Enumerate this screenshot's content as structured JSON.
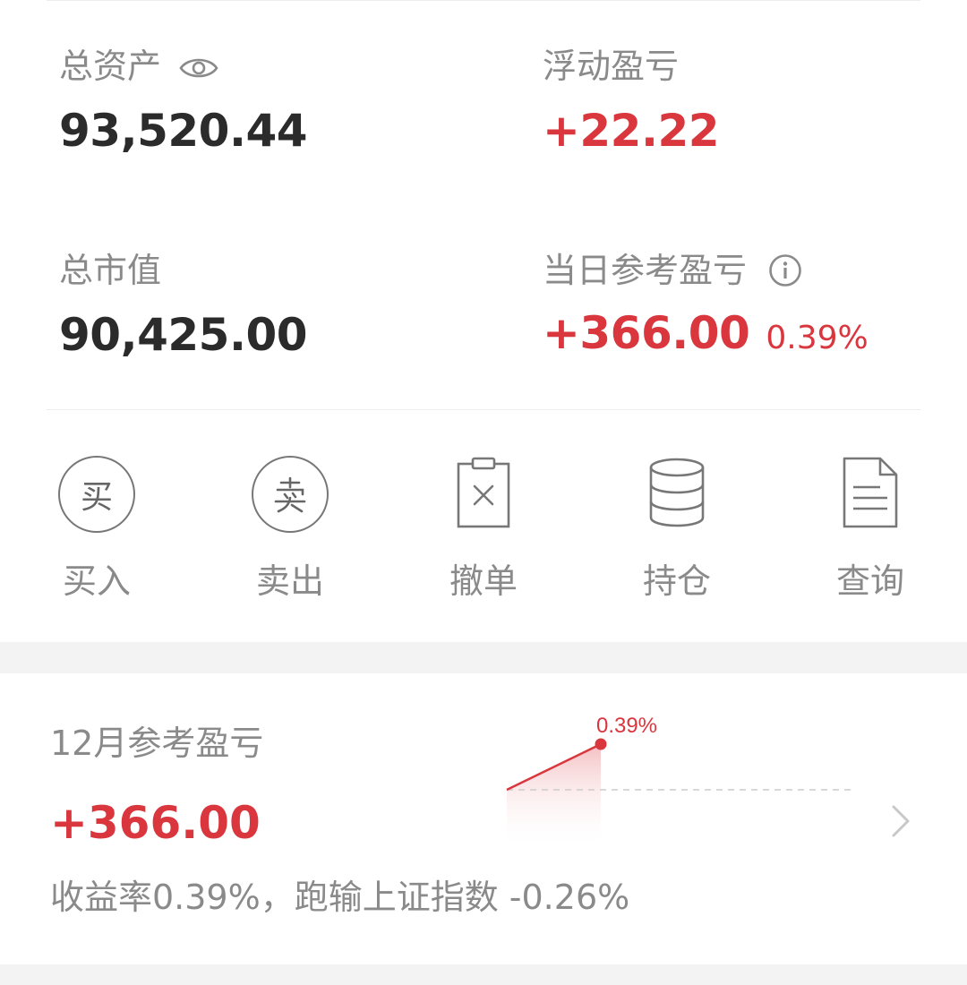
{
  "summary": {
    "total_assets": {
      "label": "总资产",
      "value": "93,520.44"
    },
    "floating_pnl": {
      "label": "浮动盈亏",
      "value": "+22.22"
    },
    "market_value": {
      "label": "总市值",
      "value": "90,425.00"
    },
    "daily_pnl": {
      "label": "当日参考盈亏",
      "value": "+366.00",
      "percent": "0.39%"
    }
  },
  "actions": [
    {
      "label": "买入",
      "icon": "buy-icon",
      "glyph": "买"
    },
    {
      "label": "卖出",
      "icon": "sell-icon",
      "glyph": "卖"
    },
    {
      "label": "撤单",
      "icon": "cancel-order-icon"
    },
    {
      "label": "持仓",
      "icon": "positions-icon"
    },
    {
      "label": "查询",
      "icon": "query-document-icon"
    }
  ],
  "monthly": {
    "label": "12月参考盈亏",
    "value": "+366.00",
    "description": "收益率0.39%，跑输上证指数 -0.26%",
    "chart_point_label": "0.39%"
  },
  "colors": {
    "accent_red": "#d9363e",
    "label_gray": "#8a8a8a",
    "value_dark": "#2b2b2b"
  }
}
